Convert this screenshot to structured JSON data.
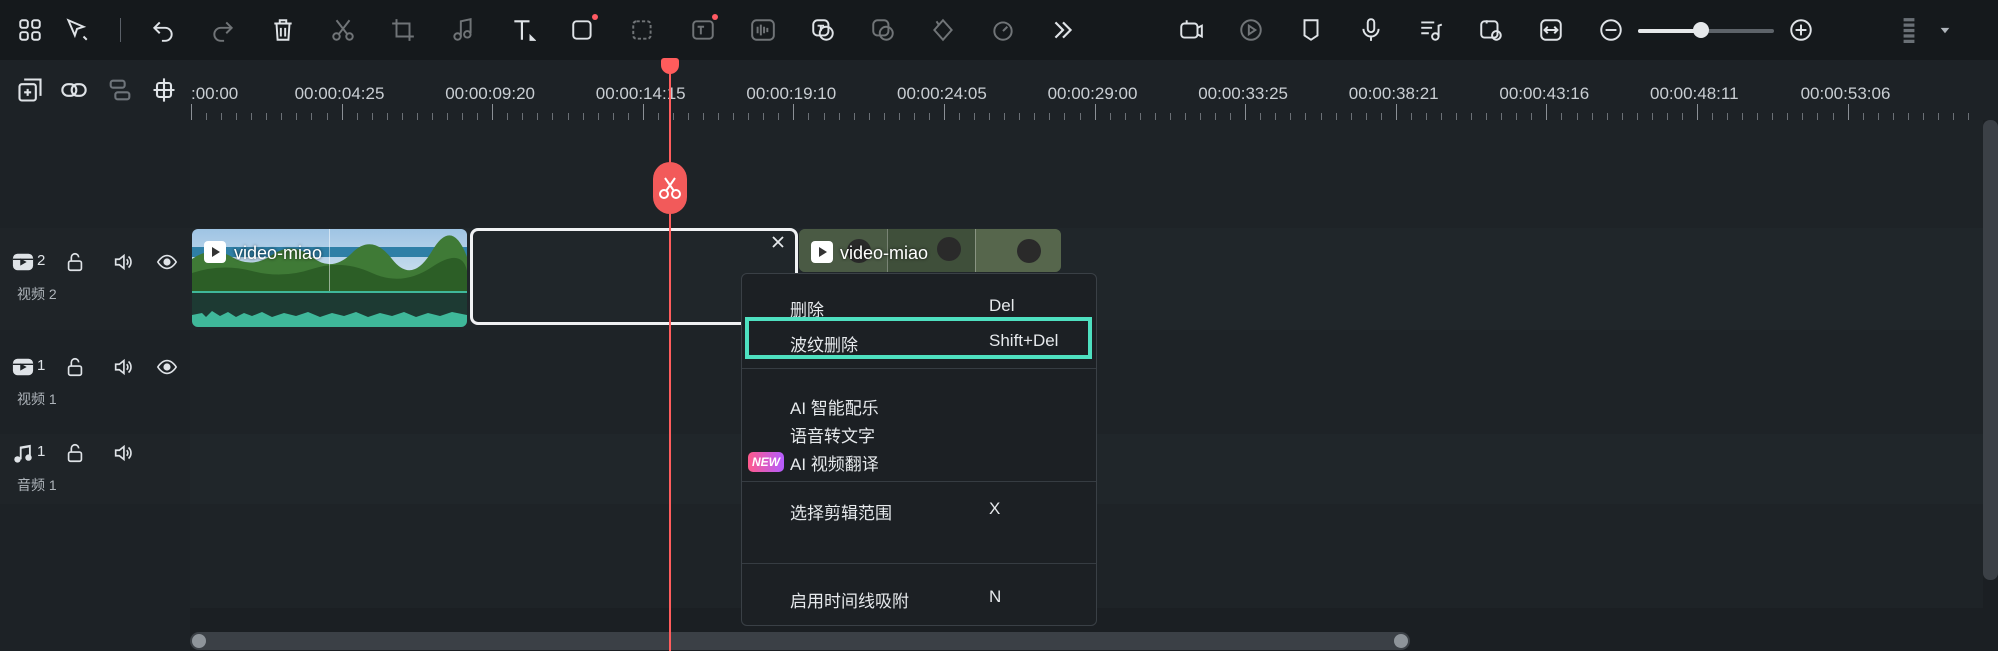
{
  "toolbar": {
    "left_icons": [
      "grid-icon",
      "select-arrow-icon",
      "undo-icon",
      "redo-icon",
      "delete-icon",
      "scissors-icon",
      "crop-icon",
      "music-note-icon",
      "text-icon",
      "shape-icon",
      "ai-select-icon",
      "ai-text-icon",
      "audio-wave-icon",
      "ai-translate-icon",
      "face-icon",
      "keyframe-icon",
      "speed-icon",
      "more-chevrons-icon"
    ],
    "right_icons": [
      "ai-video-icon",
      "ai-auto-icon",
      "marker-icon",
      "microphone-icon",
      "music-list-icon",
      "preview-render-icon",
      "fit-timeline-icon",
      "zoom-out-icon",
      "zoom-in-icon",
      "layout-menu-icon"
    ],
    "zoom_level": 0.45
  },
  "timeline": {
    "ruler_labels": [
      ":00:00",
      "00:00:04:25",
      "00:00:09:20",
      "00:00:14:15",
      "00:00:19:10",
      "00:00:24:05",
      "00:00:29:00",
      "00:00:33:25",
      "00:00:38:21",
      "00:00:43:16",
      "00:00:48:11",
      "00:00:53:06"
    ],
    "tracks": [
      {
        "number": "2",
        "name": "视频 2",
        "type": "video"
      },
      {
        "number": "1",
        "name": "视频 1",
        "type": "video"
      },
      {
        "number": "1",
        "name": "音频 1",
        "type": "audio"
      }
    ],
    "clips": [
      {
        "title": "video-miao"
      },
      {
        "title": "video-miao"
      }
    ]
  },
  "context_menu": {
    "items": [
      {
        "label": "删除",
        "shortcut": "Del"
      },
      {
        "label": "波纹删除",
        "shortcut": "Shift+Del",
        "highlighted": true
      },
      {
        "label": "AI 智能配乐",
        "shortcut": ""
      },
      {
        "label": "语音转文字",
        "shortcut": ""
      },
      {
        "label": "AI 视频翻译",
        "shortcut": "",
        "badge": "NEW"
      },
      {
        "label": "选择剪辑范围",
        "shortcut": "X"
      },
      {
        "label": "启用时间线吸附",
        "shortcut": "N"
      }
    ]
  },
  "colors": {
    "playhead": "#ff5c5c",
    "highlight": "#4ee0c0",
    "waveform": "#3fb89a"
  }
}
